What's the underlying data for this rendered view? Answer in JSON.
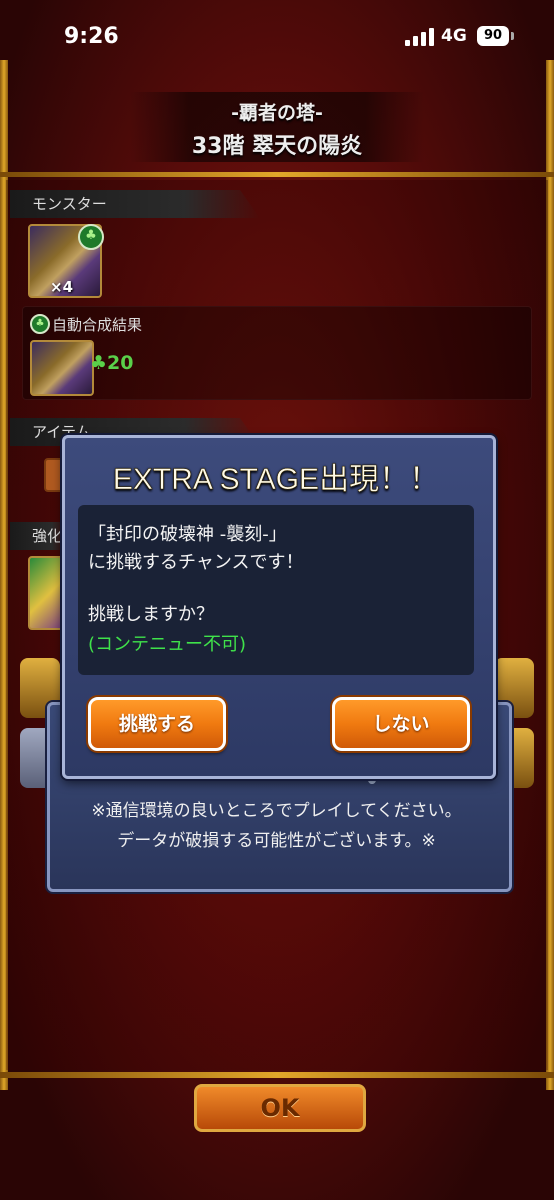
{
  "status_bar": {
    "time": "9:26",
    "network": "4G",
    "battery": "90"
  },
  "header": {
    "tower_name": "-覇者の塔-",
    "stage_name": "33階 翠天の陽炎"
  },
  "sections": {
    "monster": {
      "label": "モンスター",
      "count": "×4"
    },
    "auto_synthesis": {
      "label": "自動合成結果",
      "clover_value": "20"
    },
    "item": {
      "label": "アイテム"
    },
    "strengthen": {
      "label": "強化"
    }
  },
  "dialog": {
    "title": "EXTRA STAGE出現！！",
    "line1": "「封印の破壊神 -襲刻-」",
    "line2": "に挑戦するチャンスです！",
    "line3": "挑戦しますか？",
    "line4": "(コンテニュー不可)",
    "challenge_button": "挑戦する",
    "decline_button": "しない"
  },
  "notice": {
    "line1": "※通信環境の良いところでプレイしてください。",
    "line2": "データが破損する可能性がございます。※"
  },
  "ok_button": "OK",
  "colors": {
    "accent_orange": "#f07a10",
    "dialog_blue": "#3d4b7c",
    "green_text": "#3fe24a"
  }
}
